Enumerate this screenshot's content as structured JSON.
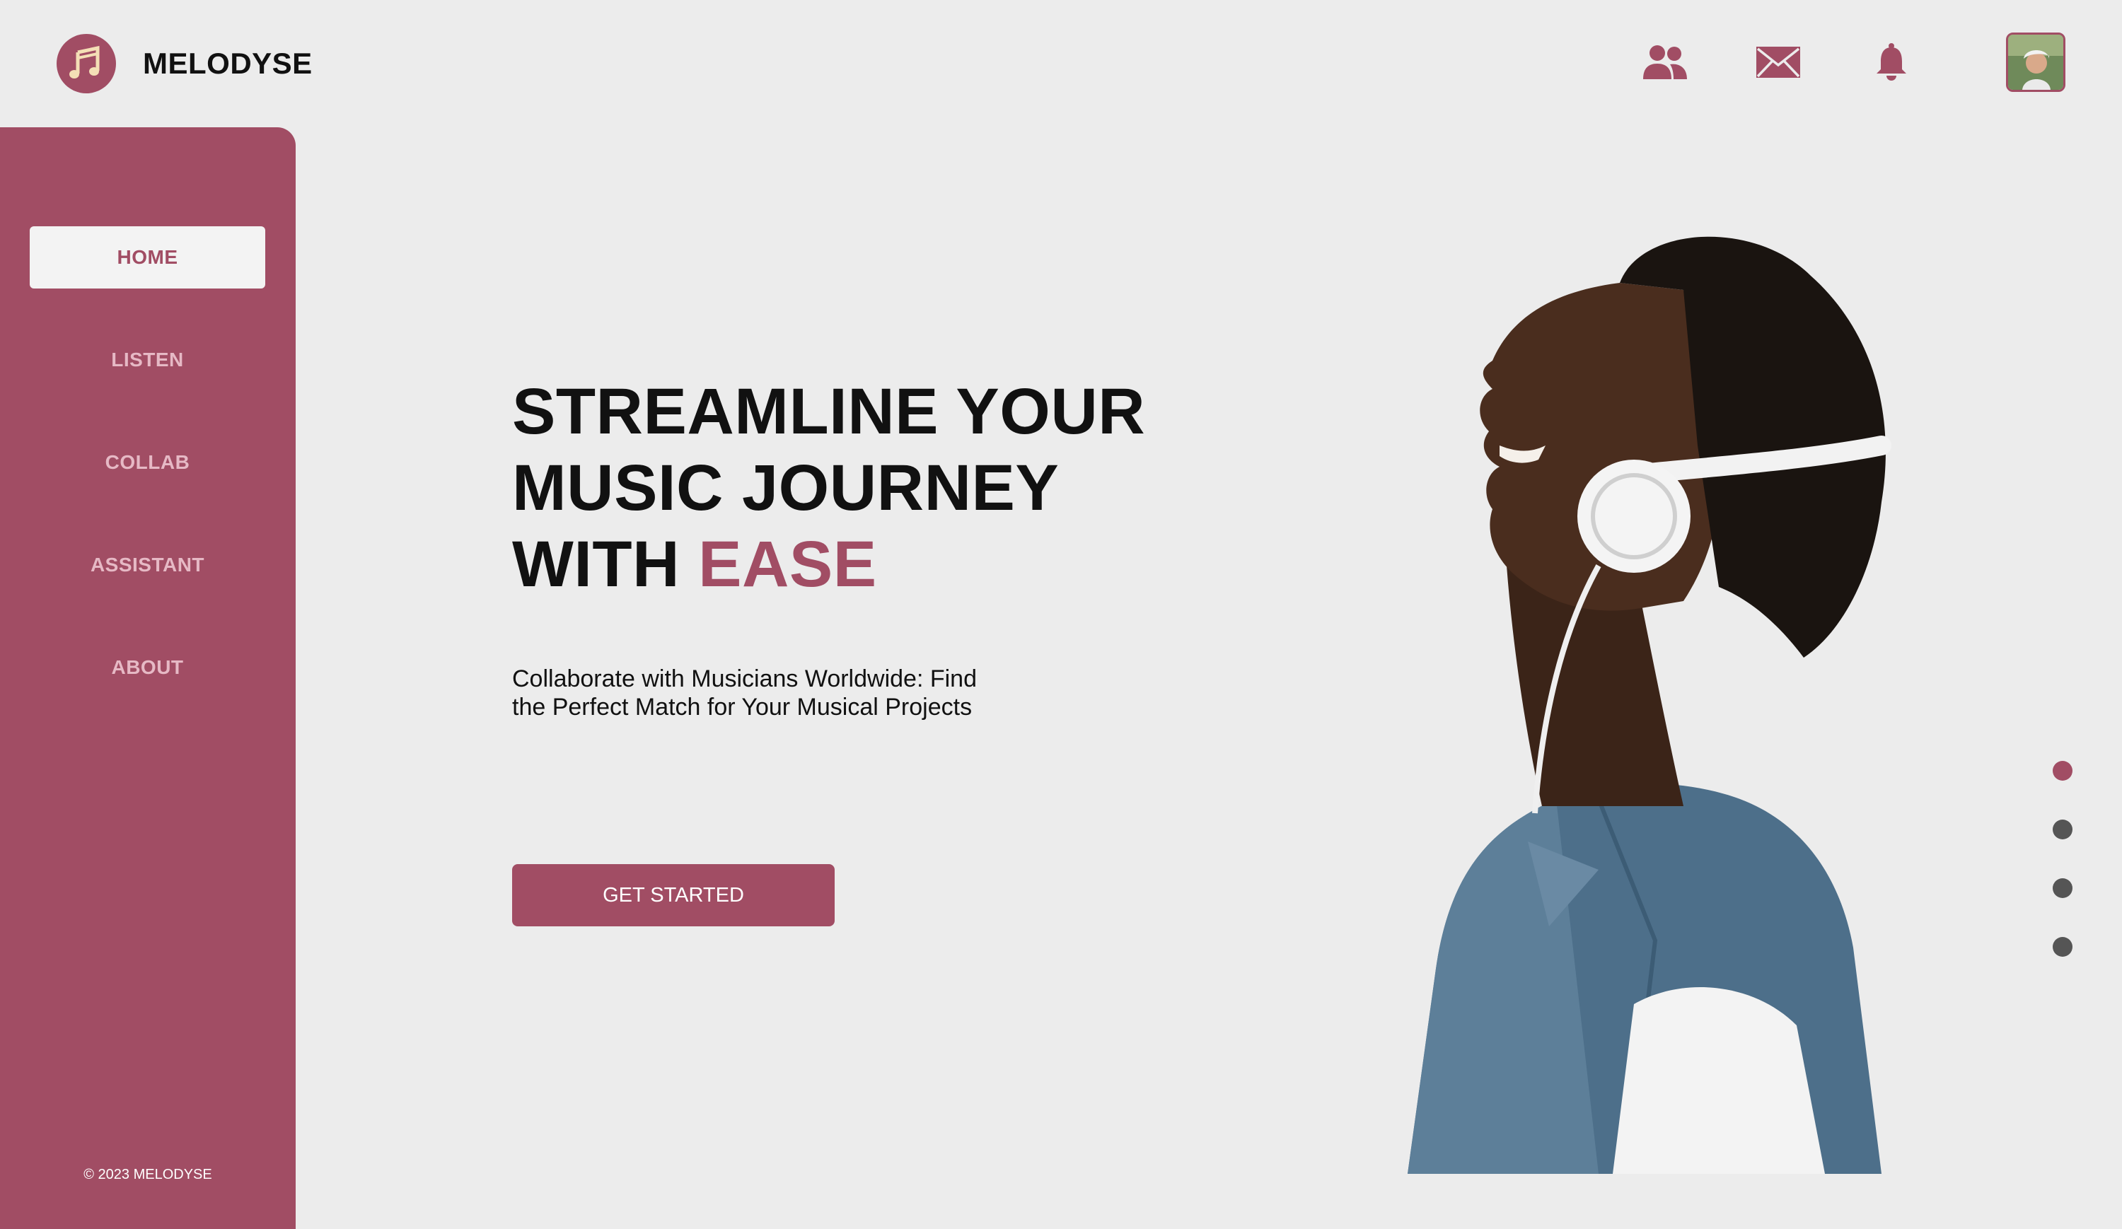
{
  "brand": {
    "name": "MELODYSE",
    "logo_icon": "music-note-icon",
    "accent_color": "#a14d64"
  },
  "topbar": {
    "icons": [
      "users-icon",
      "mail-icon",
      "bell-icon"
    ],
    "avatar": "user-avatar"
  },
  "sidebar": {
    "items": [
      {
        "label": "HOME",
        "active": true
      },
      {
        "label": "LISTEN",
        "active": false
      },
      {
        "label": "COLLAB",
        "active": false
      },
      {
        "label": "ASSISTANT",
        "active": false
      },
      {
        "label": "ABOUT",
        "active": false
      }
    ],
    "copyright": "© 2023 MELODYSE"
  },
  "hero": {
    "title_line1": "STREAMLINE YOUR",
    "title_line2": "MUSIC JOURNEY",
    "title_line3_prefix": "WITH ",
    "title_accent": "EASE",
    "subtitle": "Collaborate with Musicians Worldwide: Find the Perfect Match for Your Musical Projects",
    "cta_label": "GET STARTED"
  },
  "carousel": {
    "active_index": 0,
    "count": 4
  }
}
